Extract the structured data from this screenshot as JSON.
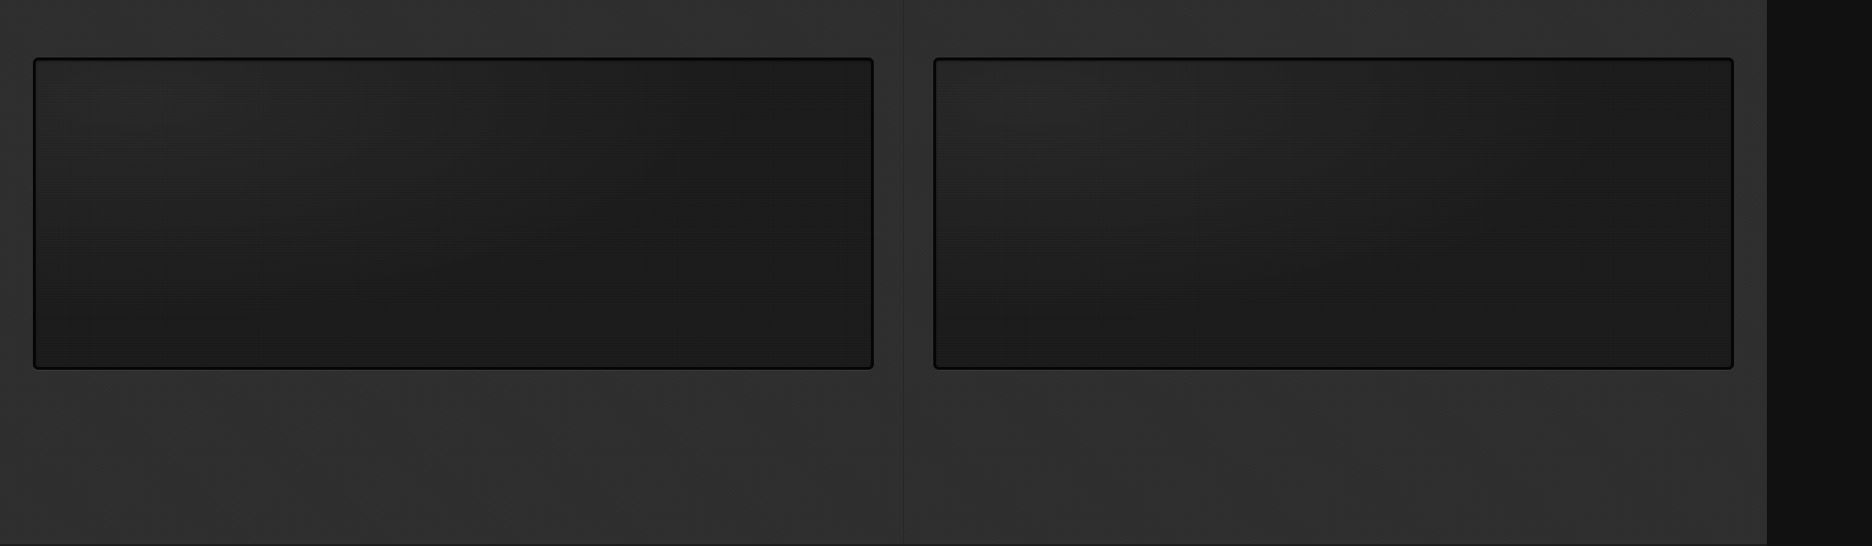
{
  "colors": {
    "background": "#2e2e2e",
    "panel_fill": "#1b1b1b",
    "panel_border": "#050505",
    "divider": "#262626",
    "right_strip": "#111111"
  },
  "panels": [
    {
      "name": "left-panel",
      "label": ""
    },
    {
      "name": "right-panel",
      "label": ""
    }
  ]
}
